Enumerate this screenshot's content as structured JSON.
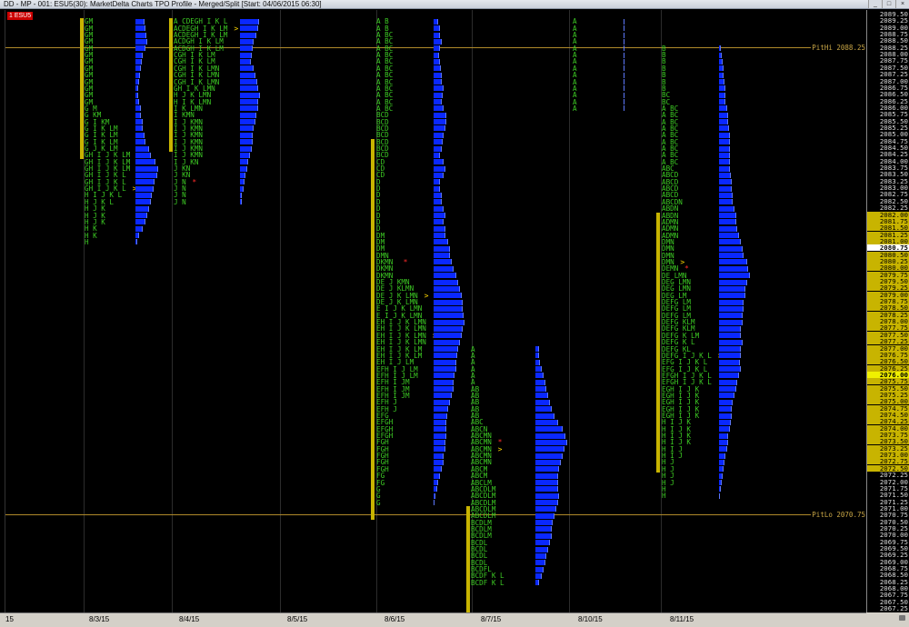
{
  "window": {
    "title": "DD - MP - 001: ESU5(30): MarketDelta Charts TPO Profile - Merged/Split [Start: 04/06/2015 06:30]",
    "buttons": [
      "_",
      "□",
      "×"
    ]
  },
  "symbol_badge": "1 ESU5",
  "price_axis": {
    "max": 2089.5,
    "min": 2067.0,
    "step": 0.25,
    "highlight_range": [
      2072.5,
      2082.0
    ],
    "current_price": 2076.0,
    "white_label": 2080.75,
    "lock_icon": "lock-icon"
  },
  "reference_lines": [
    {
      "label": "PitHi 2088.25",
      "price": 2088.25
    },
    {
      "label": "PitLo 2070.75",
      "price": 2070.75
    }
  ],
  "date_labels": [
    {
      "text": "15",
      "pos": 0.002
    },
    {
      "text": "8/3/15",
      "pos": 0.094
    },
    {
      "text": "8/4/15",
      "pos": 0.193
    },
    {
      "text": "8/5/15",
      "pos": 0.312
    },
    {
      "text": "8/6/15",
      "pos": 0.419
    },
    {
      "text": "8/7/15",
      "pos": 0.525
    },
    {
      "text": "8/10/15",
      "pos": 0.632
    },
    {
      "text": "8/11/15",
      "pos": 0.733
    }
  ],
  "colors": {
    "tpo": "#3dcc24",
    "volume": "#0a28ff",
    "value_area": "#c8b400",
    "ref_line": "#b08a2a",
    "poc_marker": "#ff2a2a"
  },
  "sessions": [
    {
      "name": "8/3/15",
      "start_price": 2089.25,
      "value_area": [
        2084.25,
        2089.25
      ],
      "rows": [
        "GM",
        "GM",
        "GM",
        "GM",
        "GM",
        "GM",
        "GM",
        "GM",
        "GM",
        "GM",
        "GM",
        "GM",
        "GM",
        "G M",
        "G KM",
        "G I KM",
        "G I K LM",
        "G I K LM",
        "G I K LM",
        "G J K LM",
        "GH I J K LM",
        "GH I J K LM",
        "GH I J K LM",
        "GH I J K L",
        "GH I J K L",
        "GH I J K L>",
        "H I J K L",
        "H J K L",
        "H J K",
        "H J K",
        "H J K",
        "H K",
        "H K",
        "H"
      ],
      "volume": [
        0.35,
        0.4,
        0.42,
        0.45,
        0.4,
        0.3,
        0.25,
        0.2,
        0.18,
        0.15,
        0.12,
        0.1,
        0.14,
        0.2,
        0.22,
        0.28,
        0.3,
        0.35,
        0.4,
        0.55,
        0.6,
        0.8,
        0.9,
        0.85,
        0.75,
        0.7,
        0.65,
        0.6,
        0.55,
        0.45,
        0.4,
        0.3,
        0.15,
        0.08
      ],
      "markers": []
    },
    {
      "name": "8/4/15",
      "start_price": 2089.25,
      "value_area": [
        2084.5,
        2089.25
      ],
      "rows": [
        "A CDEGH I K L",
        "ACDEGH I K LM>",
        "ACDEGH I K LM",
        "ACDGH I K LM",
        "ACDGH I K LM",
        "CGH I K LM",
        "CGH I K LM",
        "CGH I K LMN",
        "CGH I K LMN",
        "CGH I K LMN",
        "GH I K LMN",
        "H J K LMN",
        "H I K LMN",
        "I K LMN",
        "I KMN",
        "I J KMN",
        "I J KMN",
        "I J KMN",
        "I J KMN",
        "I J KMN",
        "I J KMN",
        "I J KN",
        "J KN",
        "J KN",
        "J N*",
        "J N",
        "J N",
        "J N"
      ],
      "volume": [
        0.7,
        0.65,
        0.6,
        0.5,
        0.45,
        0.42,
        0.4,
        0.5,
        0.55,
        0.62,
        0.68,
        0.72,
        0.68,
        0.65,
        0.6,
        0.55,
        0.5,
        0.48,
        0.45,
        0.42,
        0.35,
        0.3,
        0.25,
        0.2,
        0.15,
        0.12,
        0.08,
        0.06
      ],
      "markers": [
        {
          "row": 24,
          "type": "poc"
        }
      ]
    },
    {
      "name": "8/6/15",
      "start_price": 2089.25,
      "value_area": [
        2070.75,
        2084.75
      ],
      "rows": [
        "A B",
        "A B",
        "A BC",
        "A BC",
        "A BC",
        "A BC",
        "A BC",
        "A BC",
        "A BC",
        "A BC",
        "A BC",
        "A BC",
        "A BC",
        "A BC",
        "BCD",
        "BCD",
        "BCD",
        "BCD",
        "BCD",
        "BCD",
        "BCD",
        "CD",
        "CD",
        "CD",
        "D",
        "D",
        "D",
        "D",
        "D",
        "D",
        "D",
        "D",
        "DM",
        "DM",
        "DM",
        "DMN",
        "DKMN *",
        "DKMN",
        "DKMN",
        "DE J KMN",
        "DE J KLMN",
        "DE J K LMN>",
        "DE J K LMN",
        "E I J K LMN",
        "E I J K LMN",
        "EH I J K LMN",
        "EH I J K LMN",
        "EH I J K LMN>",
        "EH I J K LMN",
        "EH I J K LM",
        "EH I J K LM",
        "EH I J LM",
        "EFH I J LM",
        "EFH I J LM",
        "EFH I JM",
        "EFH I JM",
        "EFH I JM",
        "EFH J",
        "EFH J",
        "EFG",
        "EFGH",
        "EFGH",
        "EFGH",
        "FGH",
        "FGH",
        "FGH",
        "FGH",
        "FGH",
        "FG",
        "FG",
        "G",
        "G",
        "G"
      ],
      "volume": [
        0.15,
        0.2,
        0.2,
        0.25,
        0.2,
        0.18,
        0.2,
        0.22,
        0.25,
        0.25,
        0.3,
        0.28,
        0.25,
        0.3,
        0.4,
        0.4,
        0.35,
        0.3,
        0.28,
        0.25,
        0.2,
        0.3,
        0.35,
        0.3,
        0.2,
        0.2,
        0.25,
        0.25,
        0.3,
        0.35,
        0.3,
        0.35,
        0.35,
        0.45,
        0.5,
        0.5,
        0.55,
        0.6,
        0.7,
        0.75,
        0.8,
        0.85,
        0.88,
        0.9,
        0.92,
        0.95,
        0.9,
        0.85,
        0.8,
        0.75,
        0.72,
        0.7,
        0.7,
        0.65,
        0.6,
        0.6,
        0.55,
        0.5,
        0.45,
        0.42,
        0.4,
        0.4,
        0.38,
        0.35,
        0.35,
        0.3,
        0.3,
        0.25,
        0.2,
        0.15,
        0.1,
        0.05
      ],
      "markers": [
        {
          "row": 36,
          "type": "poc"
        }
      ]
    },
    {
      "name": "8/7/15",
      "start_price": 2077.0,
      "value_area": [
        2067.25,
        2071.0
      ],
      "rows": [
        "A",
        "A",
        "A",
        "A",
        "A",
        "A",
        "AB",
        "AB",
        "AB",
        "AB",
        "AB",
        "ABC",
        "ABCN",
        "ABCMN",
        "ABCMN*",
        "ABCMN>",
        "ABCMN",
        "ABCMN",
        "ABCM",
        "ABCM",
        "ABCLM",
        "ABCDLM",
        "ABCDLM",
        "ABCDLM",
        "ABCDLM",
        "ABCDLM",
        "BCDLM",
        "BCDLM",
        "BCDLM",
        "BCDL",
        "BCDL",
        "BCDL",
        "BCDL",
        "BCDFL",
        "BCDF K L",
        "BCDF K L"
      ],
      "volume": [
        0.1,
        0.12,
        0.15,
        0.2,
        0.25,
        0.3,
        0.35,
        0.4,
        0.45,
        0.5,
        0.6,
        0.7,
        0.85,
        0.95,
        1.0,
        0.9,
        0.85,
        0.8,
        0.75,
        0.7,
        0.7,
        0.72,
        0.75,
        0.7,
        0.65,
        0.6,
        0.55,
        0.5,
        0.5,
        0.45,
        0.4,
        0.35,
        0.3,
        0.25,
        0.2,
        0.12
      ],
      "markers": [
        {
          "row": 14,
          "type": "poc"
        }
      ]
    },
    {
      "name": "8/10/15",
      "start_price": 2089.25,
      "value_area": [],
      "rows": [
        "A",
        "A",
        "A",
        "A",
        "A",
        "A",
        "A",
        "A",
        "A",
        "A",
        "A",
        "A",
        "A",
        "A"
      ],
      "volume": [
        0.02,
        0.02,
        0.05,
        0.05,
        0.05,
        0.04,
        0.03,
        0.03,
        0.02,
        0.02,
        0.02,
        0.02,
        0.02,
        0.01
      ],
      "markers": []
    },
    {
      "name": "8/11/15",
      "start_price": 2088.25,
      "value_area": [
        2072.5,
        2082.0
      ],
      "rows": [
        "B",
        "B",
        "B",
        "B",
        "B",
        "B",
        "B",
        "BC",
        "BC",
        "A BC",
        "A BC",
        "A BC",
        "A BC",
        "A BC",
        "A BC",
        "A BC",
        "A BC",
        "A BC",
        "ABC",
        "ABCD",
        "ABCD",
        "ABCD",
        "ABCD",
        "ABCDN",
        "ABDN",
        "ABDN",
        "ADMN",
        "ADMN",
        "ADMN",
        "DMN",
        "DMN",
        "DMN",
        "DMN>",
        "DEMN*",
        "DE LMN",
        "DEG LMN",
        "DEG LMN",
        "DEG LM",
        "DEFG LM",
        "DEFG LM",
        "DEFG LM",
        "DEFG KLM",
        "DEFG KLM",
        "DEFG K LM",
        "DEFG K L",
        "DEFG KL",
        "DEFG I J K L>",
        "EFG I J K L",
        "EFG I J K L",
        "EFGH I J K L",
        "EFGH I J K L",
        "EGH I J K",
        "EGH I J K",
        "EGH I J K",
        "EGH I J K",
        "EGH I J K",
        "H I J K",
        "H I J K",
        "H I J K",
        "H I J K",
        "H I J",
        "H I J",
        "H J",
        "H J",
        "H J",
        "H J",
        "H",
        "H"
      ],
      "volume": [
        0.05,
        0.1,
        0.12,
        0.15,
        0.15,
        0.18,
        0.2,
        0.2,
        0.22,
        0.25,
        0.3,
        0.3,
        0.32,
        0.35,
        0.35,
        0.35,
        0.35,
        0.35,
        0.35,
        0.38,
        0.4,
        0.42,
        0.45,
        0.45,
        0.5,
        0.55,
        0.55,
        0.6,
        0.65,
        0.7,
        0.75,
        0.8,
        0.9,
        0.95,
        1.0,
        0.9,
        0.85,
        0.85,
        0.8,
        0.78,
        0.75,
        0.75,
        0.7,
        0.72,
        0.75,
        0.72,
        0.7,
        0.68,
        0.7,
        0.65,
        0.6,
        0.55,
        0.5,
        0.45,
        0.4,
        0.4,
        0.38,
        0.35,
        0.3,
        0.28,
        0.25,
        0.2,
        0.18,
        0.15,
        0.12,
        0.08,
        0.05,
        0.03
      ],
      "markers": [
        {
          "row": 33,
          "type": "poc"
        }
      ]
    }
  ]
}
